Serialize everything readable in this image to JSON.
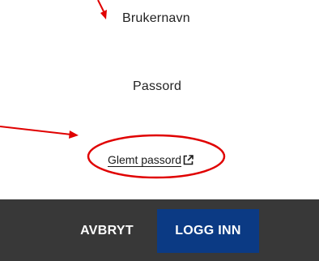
{
  "form": {
    "username_label": "Brukernavn",
    "password_label": "Passord",
    "forgot_password_link": "Glemt passord"
  },
  "icons": {
    "forgot_password": "external-link-icon"
  },
  "footer": {
    "cancel_label": "AVBRYT",
    "login_label": "LOGG INN"
  },
  "colors": {
    "annotation": "#e00000",
    "footer_background": "#383838",
    "primary_button": "#0b3a84"
  }
}
